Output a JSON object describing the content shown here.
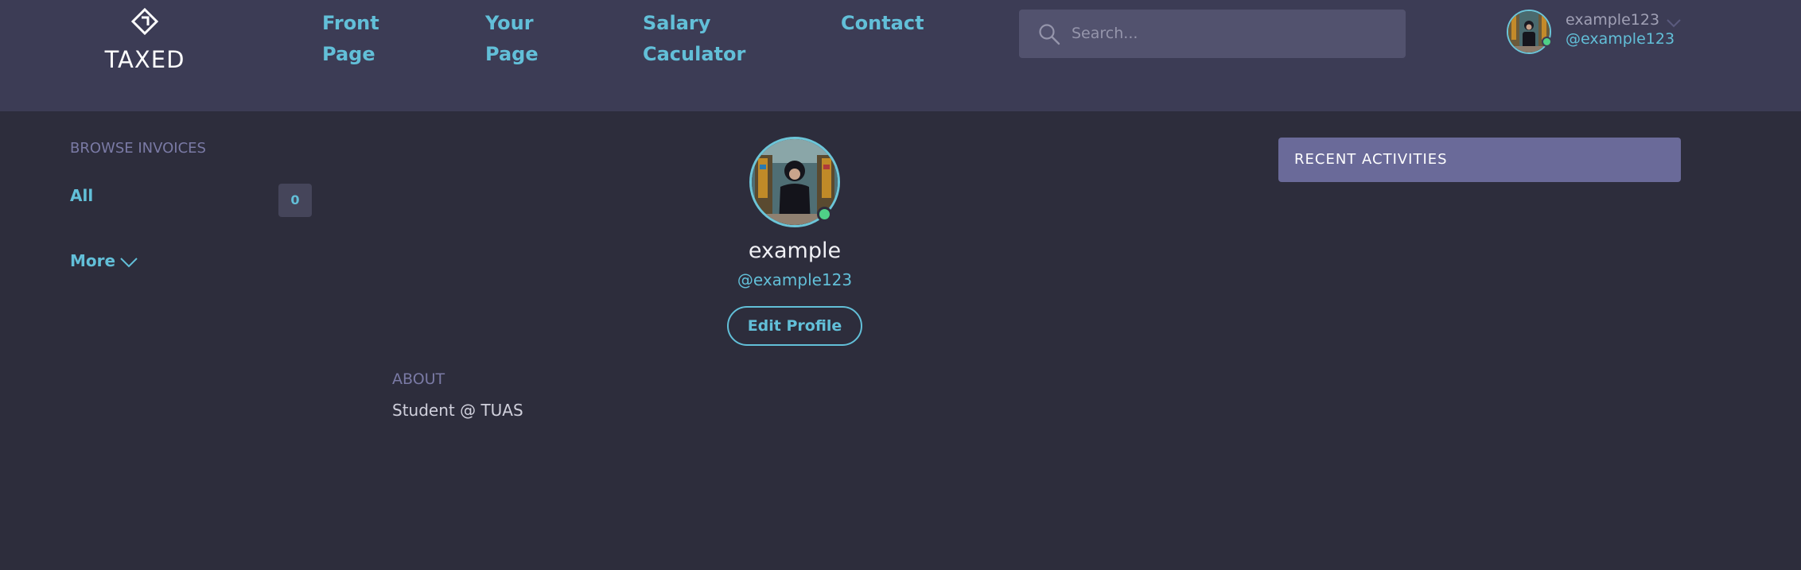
{
  "header": {
    "logo_text": "TAXED",
    "nav": [
      {
        "line1": "Front",
        "line2": "Page"
      },
      {
        "line1": "Your",
        "line2": "Page"
      },
      {
        "line1": "Salary",
        "line2": "Caculator"
      },
      {
        "line1": "Contact",
        "line2": ""
      }
    ],
    "search": {
      "placeholder": "Search...",
      "value": ""
    },
    "user": {
      "name": "example123",
      "handle": "@example123"
    }
  },
  "sidebar": {
    "title": "BROWSE INVOICES",
    "items": [
      {
        "label": "All",
        "count": "0"
      }
    ],
    "more_label": "More"
  },
  "profile": {
    "name": "example",
    "handle": "@example123",
    "edit_label": "Edit Profile",
    "about_title": "ABOUT",
    "about_text": "Student @ TUAS"
  },
  "activities": {
    "title": "RECENT ACTIVITIES"
  },
  "colors": {
    "background": "#2d2d3c",
    "header": "#3c3c55",
    "accent": "#62bfd8",
    "online": "#4fd087",
    "activities_header": "#6a6a99"
  },
  "icons": [
    "logo-mark-icon",
    "search-icon",
    "chevron-down-icon",
    "online-status-icon"
  ]
}
